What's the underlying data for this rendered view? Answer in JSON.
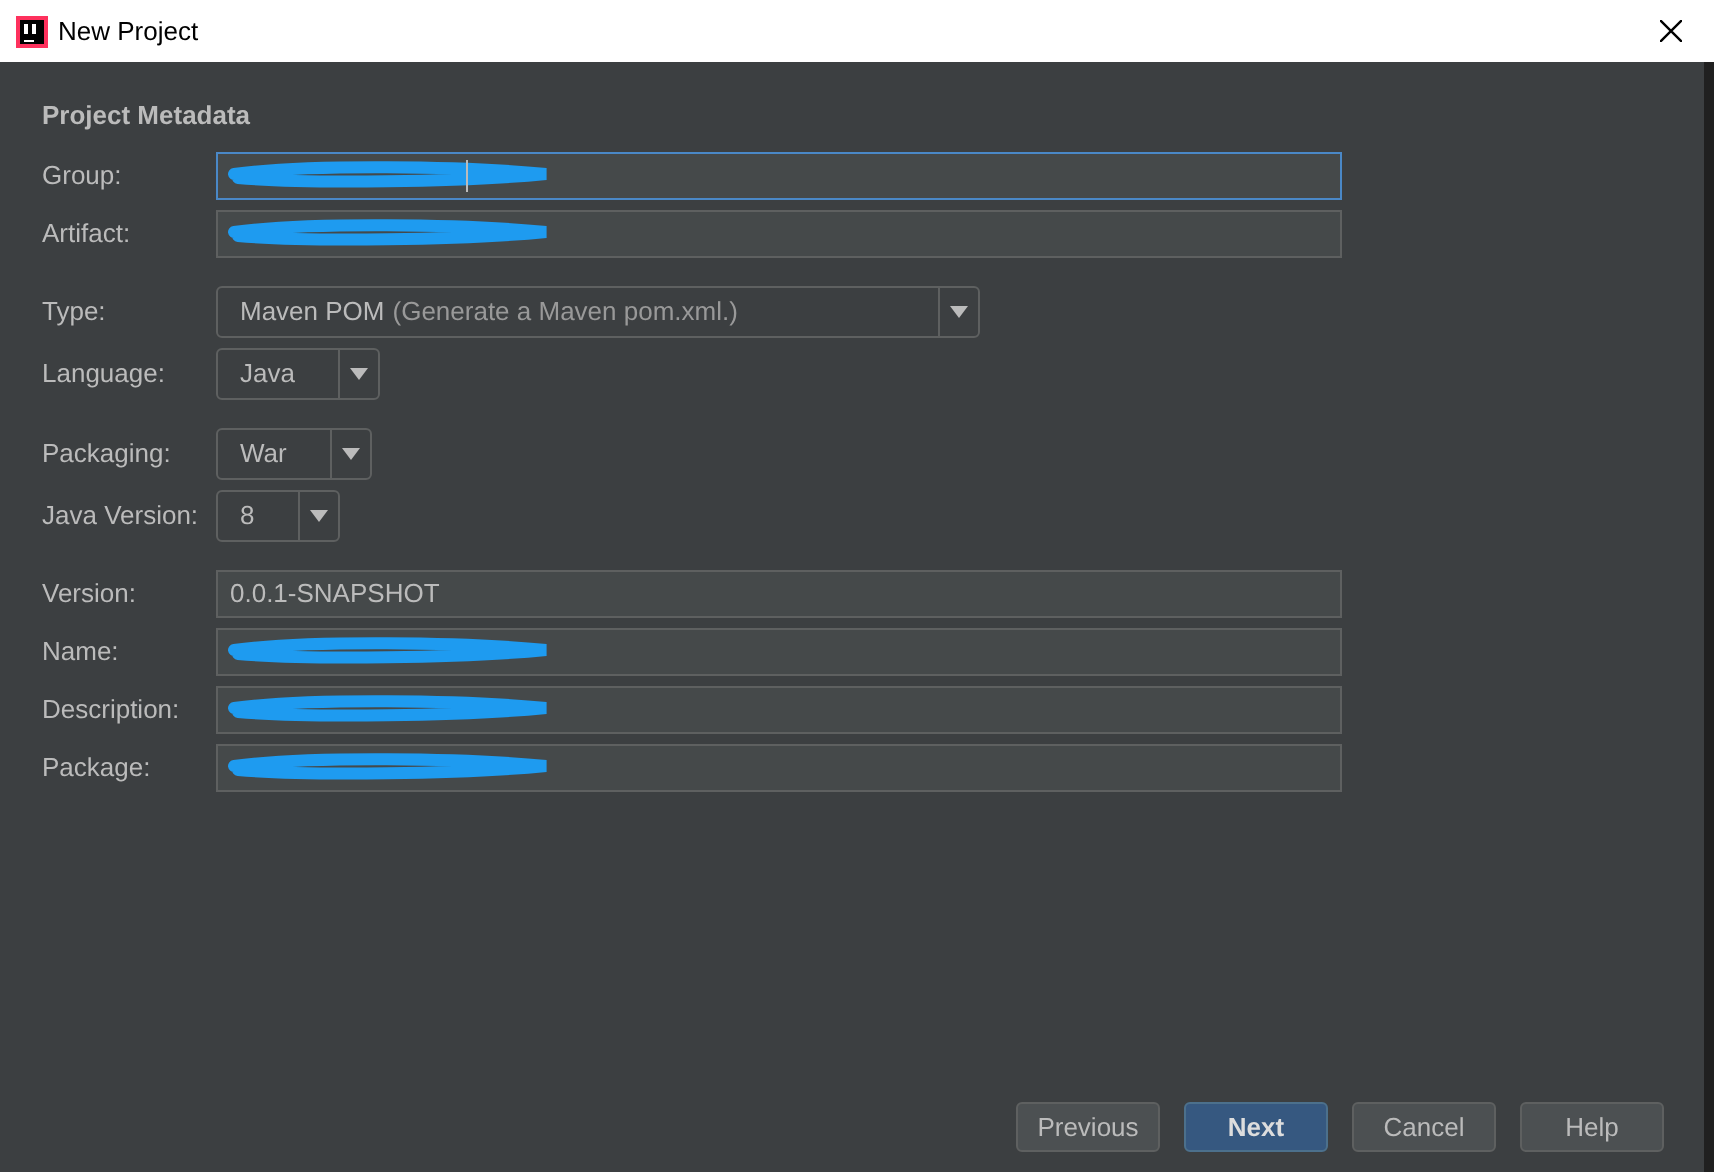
{
  "window": {
    "title": "New Project"
  },
  "section_title": "Project Metadata",
  "groups": [
    [
      {
        "kind": "text",
        "label": "Group:",
        "redacted": true,
        "focused": true
      },
      {
        "kind": "text",
        "label": "Artifact:",
        "redacted": true,
        "focused": false
      }
    ],
    [
      {
        "kind": "dropdown",
        "label": "Type:",
        "value": "Maven POM",
        "hint": "(Generate a Maven pom.xml.)"
      },
      {
        "kind": "dropdown",
        "label": "Language:",
        "value": "Java"
      }
    ],
    [
      {
        "kind": "dropdown",
        "label": "Packaging:",
        "value": "War"
      },
      {
        "kind": "dropdown",
        "label": "Java Version:",
        "value": "8"
      }
    ],
    [
      {
        "kind": "text",
        "label": "Version:",
        "value": "0.0.1-SNAPSHOT",
        "redacted": false,
        "focused": false
      },
      {
        "kind": "text",
        "label": "Name:",
        "redacted": true,
        "focused": false
      },
      {
        "kind": "text",
        "label": "Description:",
        "redacted": true,
        "focused": false
      },
      {
        "kind": "text",
        "label": "Package:",
        "redacted": true,
        "focused": false
      }
    ]
  ],
  "buttons": [
    {
      "label": "Previous",
      "default": false
    },
    {
      "label": "Next",
      "default": true
    },
    {
      "label": "Cancel",
      "default": false
    },
    {
      "label": "Help",
      "default": false
    }
  ]
}
